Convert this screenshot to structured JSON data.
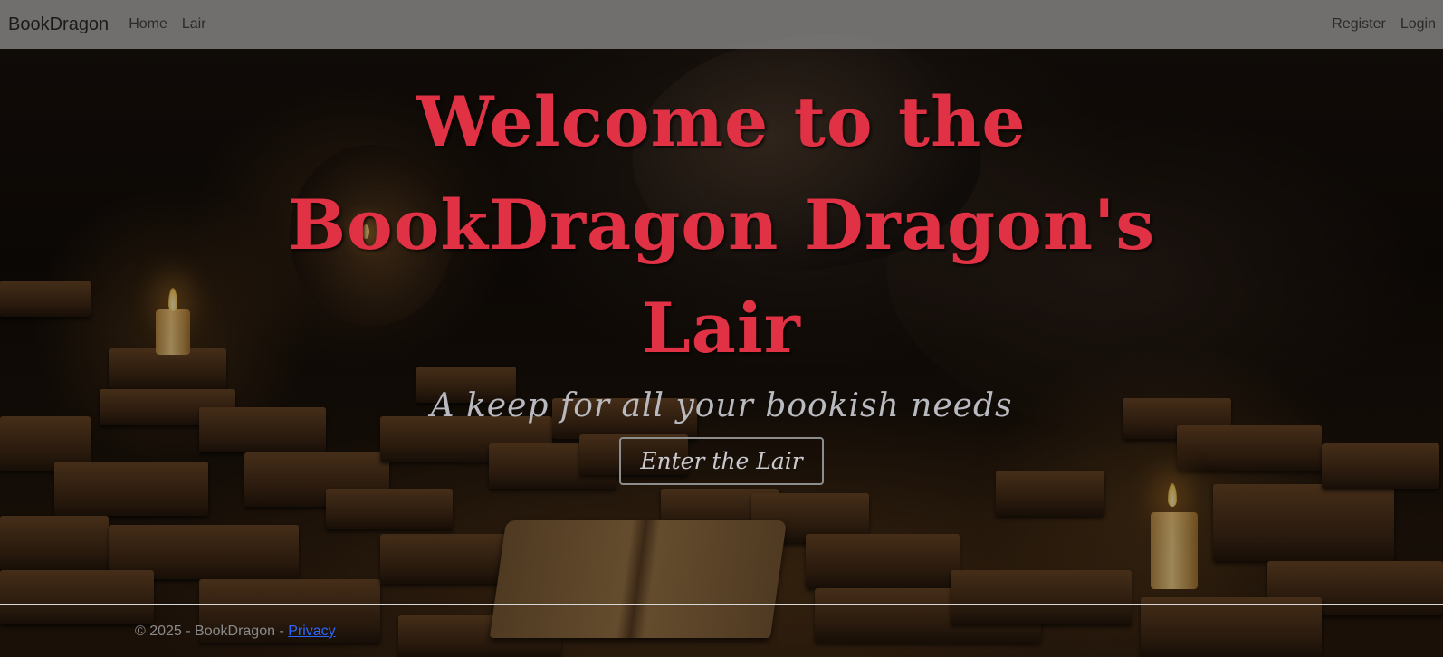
{
  "navbar": {
    "brand": "BookDragon",
    "links": [
      {
        "label": "Home"
      },
      {
        "label": "Lair"
      }
    ],
    "right_links": [
      {
        "label": "Register"
      },
      {
        "label": "Login"
      }
    ]
  },
  "hero": {
    "title": "Welcome to the BookDragon Dragon's Lair",
    "subtitle": "A keep for all your bookish needs",
    "button_label": "Enter the Lair"
  },
  "footer": {
    "copyright": "© 2025 - BookDragon - ",
    "privacy_label": "Privacy"
  },
  "colors": {
    "title": "#e03244",
    "subtitle": "#b9b9c0",
    "navbar_bg": "#969696",
    "link": "#2b66ff"
  },
  "icons": [
    "candle-image",
    "dragon-image",
    "books-image"
  ]
}
